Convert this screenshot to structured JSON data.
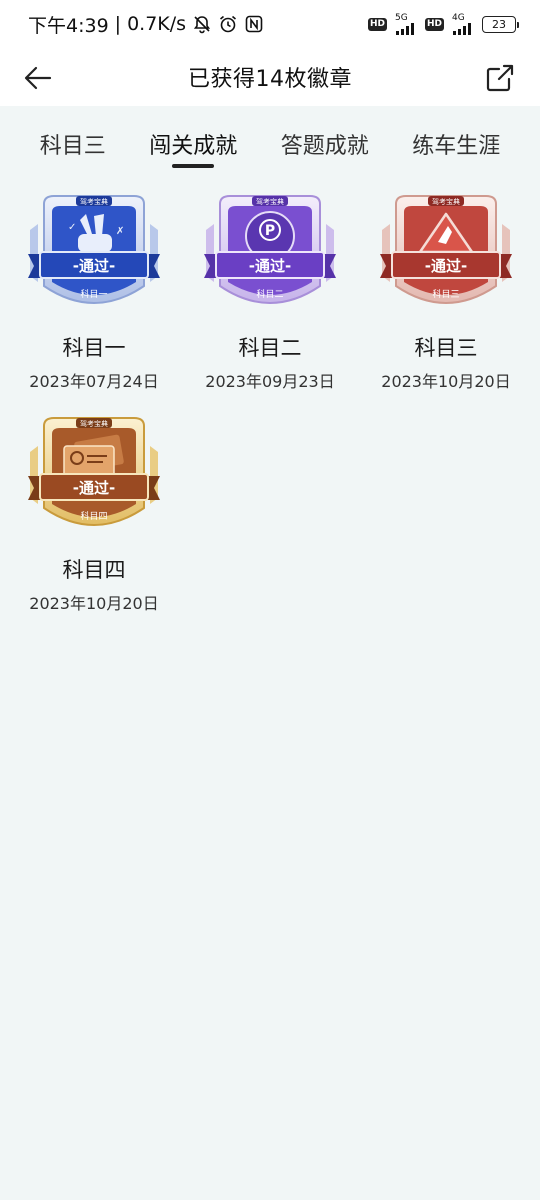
{
  "status_bar": {
    "time": "下午4:39",
    "speed": "0.7K/s",
    "hd1": "HD",
    "net1": "5G",
    "hd2": "HD",
    "net2": "4G",
    "battery": "23"
  },
  "header": {
    "title": "已获得14枚徽章"
  },
  "tabs": [
    {
      "label": "科目三",
      "active": false
    },
    {
      "label": "闯关成就",
      "active": true
    },
    {
      "label": "答题成就",
      "active": false
    },
    {
      "label": "练车生涯",
      "active": false
    }
  ],
  "badges": [
    {
      "name": "科目一",
      "date": "2023年07月24日",
      "ribbon": "-通过-",
      "plate": "科目一",
      "brand": "驾考宝典",
      "theme": "blue",
      "colors": {
        "main": "#2f55c8",
        "dark": "#1d3a9a",
        "light": "#c9d7f2",
        "ribbon": "#2448b8"
      }
    },
    {
      "name": "科目二",
      "date": "2023年09月23日",
      "ribbon": "-通过-",
      "plate": "科目二",
      "brand": "驾考宝典",
      "theme": "purple",
      "colors": {
        "main": "#7a4fd0",
        "dark": "#5632a8",
        "light": "#ddd0f2",
        "ribbon": "#6a3fc4"
      }
    },
    {
      "name": "科目三",
      "date": "2023年10月20日",
      "ribbon": "-通过-",
      "plate": "科目三",
      "brand": "驾考宝典",
      "theme": "red",
      "colors": {
        "main": "#c0473e",
        "dark": "#8e2a24",
        "light": "#f0d6d0",
        "ribbon": "#a8372f"
      }
    },
    {
      "name": "科目四",
      "date": "2023年10月20日",
      "ribbon": "-通过-",
      "plate": "科目四",
      "brand": "驾考宝典",
      "theme": "gold",
      "colors": {
        "main": "#a85a2a",
        "dark": "#7a3d18",
        "light": "#f0dca0",
        "ribbon": "#9a4a22"
      }
    }
  ]
}
